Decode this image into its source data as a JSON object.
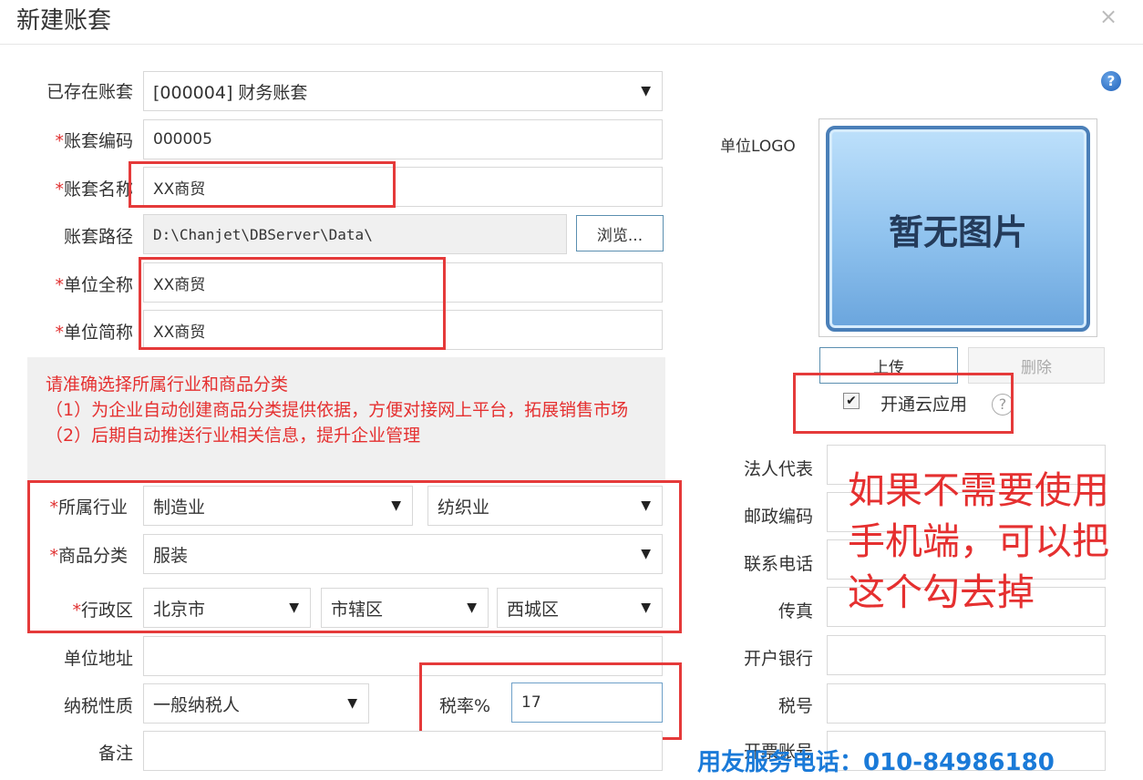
{
  "dialog": {
    "title": "新建账套",
    "close_glyph": "×"
  },
  "help_icon": "?",
  "existing": {
    "label": "已存在账套",
    "value": "[000004] 财务账套"
  },
  "code": {
    "star": "*",
    "label": "账套编码",
    "value": "000005"
  },
  "name": {
    "star": "*",
    "label": "账套名称",
    "value": "XX商贸"
  },
  "path": {
    "label": "账套路径",
    "value": "D:\\Chanjet\\DBServer\\Data\\",
    "browse": "浏览..."
  },
  "fullname": {
    "star": "*",
    "label": "单位全称",
    "value": "XX商贸"
  },
  "shortname": {
    "star": "*",
    "label": "单位简称",
    "value": "XX商贸"
  },
  "notice": {
    "line1": "请准确选择所属行业和商品分类",
    "line2": "（1）为企业自动创建商品分类提供依据，方便对接网上平台，拓展销售市场",
    "line3": "（2）后期自动推送行业相关信息，提升企业管理"
  },
  "industry": {
    "star": "*",
    "label": "所属行业",
    "value1": "制造业",
    "value2": "纺织业"
  },
  "category": {
    "star": "*",
    "label": "商品分类",
    "value": "服装"
  },
  "region": {
    "star": "*",
    "label": "行政区",
    "province": "北京市",
    "city": "市辖区",
    "district": "西城区"
  },
  "address": {
    "label": "单位地址",
    "value": ""
  },
  "taxtype": {
    "label": "纳税性质",
    "value": "一般纳税人"
  },
  "taxrate": {
    "label": "税率%",
    "value": "17"
  },
  "remark": {
    "label": "备注",
    "value": ""
  },
  "logo": {
    "label": "单位LOGO",
    "placeholder": "暂无图片",
    "upload": "上传",
    "delete": "删除"
  },
  "cloud": {
    "label": "开通云应用",
    "checked": true,
    "check_glyph": "✔",
    "help": "?"
  },
  "right": {
    "legal": "法人代表",
    "postcode": "邮政编码",
    "phone": "联系电话",
    "fax": "传真",
    "bank": "开户银行",
    "taxno": "税号",
    "account": "开票账号"
  },
  "annotation": "如果不需要使用手机端，可以把这个勾去掉",
  "footer": "用友服务电话：010-84986180",
  "colors": {
    "highlight": "#e53a3a",
    "required": "#e03030",
    "link_blue": "#1a7ad8"
  }
}
